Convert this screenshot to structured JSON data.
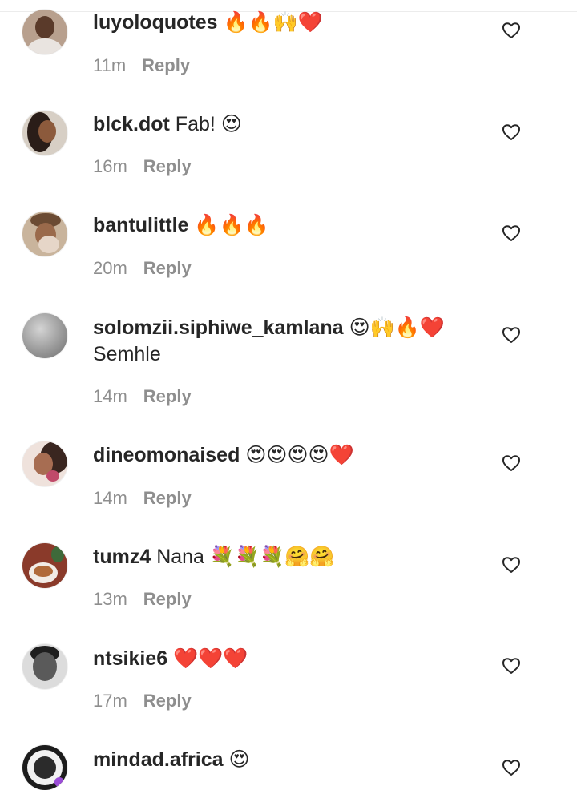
{
  "reply_label": "Reply",
  "colors": {
    "username": "#262626",
    "meta": "#8e8e8e",
    "heart_outline": "#262626"
  },
  "comments": [
    {
      "username": "luyoloquotes",
      "text": "",
      "emoji": "🔥🔥🙌❤️",
      "extra_line": "",
      "time": "11m",
      "avatar": "avatar-man-portrait",
      "like_icon": "heart-outline-icon"
    },
    {
      "username": "blck.dot",
      "text": "Fab!",
      "emoji": "😍",
      "extra_line": "",
      "time": "16m",
      "avatar": "avatar-woman-portrait",
      "like_icon": "heart-outline-icon"
    },
    {
      "username": "bantulittle",
      "text": "",
      "emoji": "🔥🔥🔥",
      "extra_line": "",
      "time": "20m",
      "avatar": "avatar-selfie",
      "like_icon": "heart-outline-icon"
    },
    {
      "username": "solomzii.siphiwe_kamlana",
      "text": "",
      "emoji": "😍🙌🔥❤️",
      "extra_line": "Semhle",
      "time": "14m",
      "avatar": "avatar-default-grey",
      "like_icon": "heart-outline-icon"
    },
    {
      "username": "dineomonaised",
      "text": "",
      "emoji": "😍😍😍😍❤️",
      "extra_line": "",
      "time": "14m",
      "avatar": "avatar-woman-selfie",
      "like_icon": "heart-outline-icon"
    },
    {
      "username": "tumz4",
      "text": "Nana",
      "emoji": "💐💐💐🤗🤗",
      "extra_line": "",
      "time": "13m",
      "avatar": "avatar-teacup",
      "like_icon": "heart-outline-icon"
    },
    {
      "username": "ntsikie6",
      "text": "",
      "emoji": "❤️❤️❤️",
      "extra_line": "",
      "time": "17m",
      "avatar": "avatar-bw-portrait",
      "like_icon": "heart-outline-icon"
    },
    {
      "username": "mindad.africa",
      "text": "",
      "emoji": "😍",
      "extra_line": "",
      "time": "",
      "avatar": "avatar-logo-badge",
      "like_icon": "heart-outline-icon"
    }
  ]
}
